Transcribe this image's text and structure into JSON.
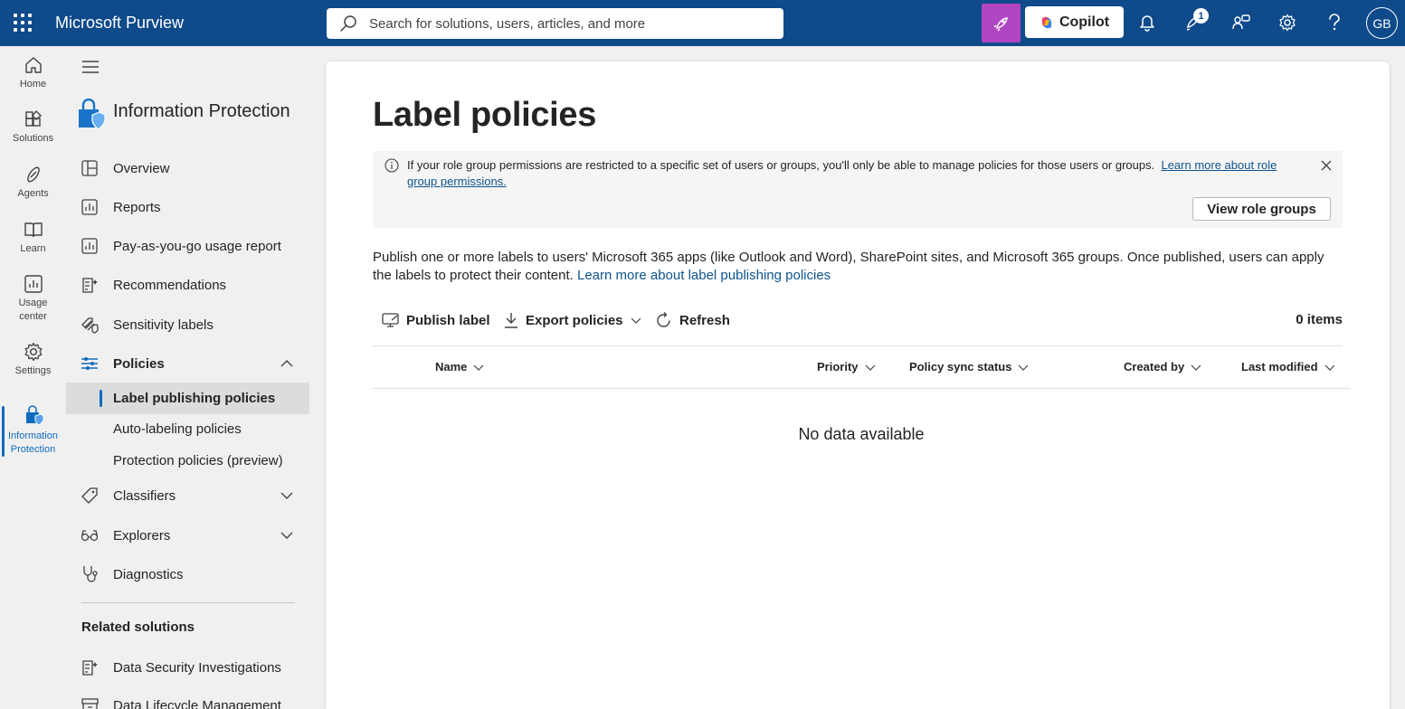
{
  "topbar": {
    "brand": "Microsoft Purview",
    "search_placeholder": "Search for solutions, users, articles, and more",
    "copilot_label": "Copilot",
    "notification_count": "1",
    "avatar_initials": "GB"
  },
  "rail": {
    "items": [
      {
        "label": "Home",
        "icon": "home-icon"
      },
      {
        "label": "Solutions",
        "icon": "solutions-icon"
      },
      {
        "label": "Agents",
        "icon": "agents-icon"
      },
      {
        "label": "Learn",
        "icon": "book-icon"
      },
      {
        "label": "Usage center",
        "icon": "chart-icon"
      },
      {
        "label": "Settings",
        "icon": "gear-icon"
      },
      {
        "label": "Information Protection",
        "icon": "info-protection-icon"
      }
    ]
  },
  "nav": {
    "title": "Information Protection",
    "items": [
      {
        "label": "Overview",
        "icon": "overview-icon"
      },
      {
        "label": "Reports",
        "icon": "reports-icon"
      },
      {
        "label": "Pay-as-you-go usage report",
        "icon": "usage-report-icon"
      },
      {
        "label": "Recommendations",
        "icon": "recommendations-icon"
      },
      {
        "label": "Sensitivity labels",
        "icon": "sensitivity-labels-icon"
      },
      {
        "label": "Policies",
        "icon": "policies-icon"
      }
    ],
    "policies_sub": [
      {
        "label": "Label publishing policies"
      },
      {
        "label": "Auto-labeling policies"
      },
      {
        "label": "Protection policies (preview)"
      }
    ],
    "items2": [
      {
        "label": "Classifiers",
        "icon": "tag-icon"
      },
      {
        "label": "Explorers",
        "icon": "glasses-icon"
      },
      {
        "label": "Diagnostics",
        "icon": "diagnostics-icon"
      }
    ],
    "related_title": "Related solutions",
    "related": [
      {
        "label": "Data Security Investigations",
        "icon": "investigations-icon"
      },
      {
        "label": "Data Lifecycle Management",
        "icon": "archive-icon"
      }
    ]
  },
  "main": {
    "title": "Label policies",
    "info_text": "If your role group permissions are restricted to a specific set of users or groups, you'll only be able to manage policies for those users or groups.",
    "info_link": "Learn more about role group permissions.",
    "role_button": "View role groups",
    "description": "Publish one or more labels to users' Microsoft 365 apps (like Outlook and Word), SharePoint sites, and Microsoft 365 groups. Once published, users can apply the labels to protect their content.",
    "description_link": "Learn more about label publishing policies",
    "commands": {
      "publish": "Publish label",
      "export": "Export policies",
      "refresh": "Refresh"
    },
    "items_count": "0 items",
    "columns": [
      "Name",
      "Priority",
      "Policy sync status",
      "Created by",
      "Last modified"
    ],
    "empty_text": "No data available"
  }
}
